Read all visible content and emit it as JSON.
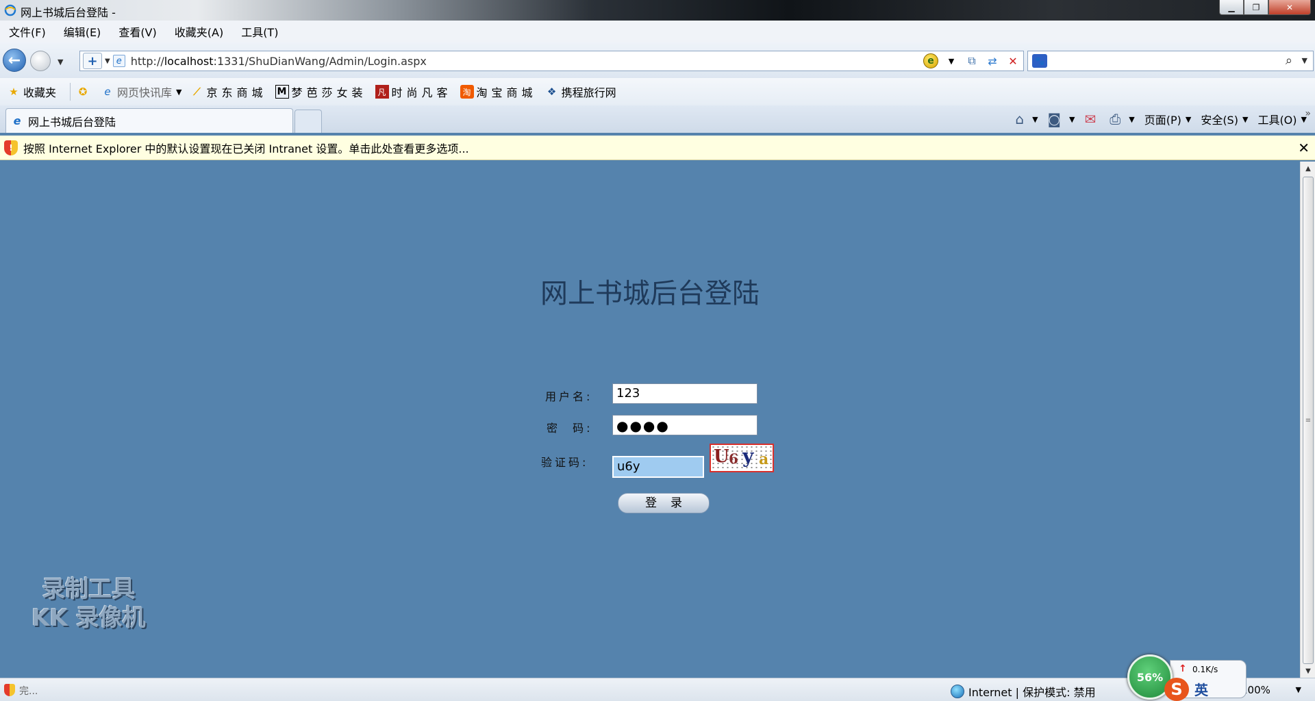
{
  "window": {
    "title": "网上书城后台登陆 -",
    "controls": [
      "minimize",
      "maximize",
      "close"
    ]
  },
  "menu": [
    "文件(F)",
    "编辑(E)",
    "查看(V)",
    "收藏夹(A)",
    "工具(T)"
  ],
  "address": {
    "prefix": "http://",
    "host": "localhost",
    "rest": ":1331/ShuDianWang/Admin/Login.aspx"
  },
  "favorites": {
    "label": "收藏夹",
    "items": [
      {
        "label": "网页快讯库",
        "icon": "web-slice-icon"
      },
      {
        "label": "京东商城",
        "icon": "jd-icon"
      },
      {
        "label": "梦芭莎女装",
        "icon": "m-icon"
      },
      {
        "label": "时尚凡客",
        "icon": "vancl-icon"
      },
      {
        "label": "淘宝商城",
        "icon": "taobao-icon"
      },
      {
        "label": "携程旅行网",
        "icon": "ctrip-icon"
      }
    ]
  },
  "tab": {
    "label": "网上书城后台登陆"
  },
  "commands": {
    "page": "页面(P)",
    "safety": "安全(S)",
    "tools": "工具(O)"
  },
  "infobar": {
    "text": "按照 Internet Explorer 中的默认设置现在已关闭 Intranet 设置。单击此处查看更多选项..."
  },
  "login": {
    "title": "网上书城后台登陆",
    "username_label": "用户名:",
    "username_value": "123",
    "password_label": "密  码:",
    "password_value": "●●●●",
    "code_label": "验证码:",
    "code_value": "u6y",
    "captcha_chars": [
      "U",
      "6",
      "y",
      "a"
    ],
    "submit_label": "登录"
  },
  "watermark": {
    "line1": "录制工具",
    "line2": "KK 录像机"
  },
  "status": {
    "left_text": "完...",
    "zone": "Internet | 保护模式: 禁用",
    "zoom": "100%",
    "speed_percent": "56%",
    "speed_rate": "0.1K/s",
    "ime": "英"
  }
}
